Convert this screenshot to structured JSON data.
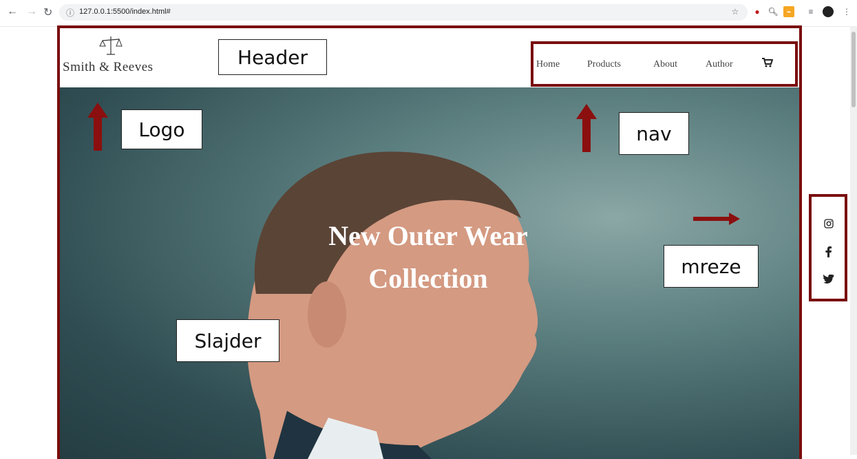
{
  "browser": {
    "url": "127.0.0.1:5500/index.html#",
    "back_icon": "arrow-left",
    "forward_icon": "arrow-right",
    "reload_icon": "reload"
  },
  "header": {
    "logo_text": "Smith & Reeves",
    "nav": [
      "Home",
      "Products",
      "About",
      "Author"
    ],
    "cart_icon": "cart-icon"
  },
  "slider": {
    "title_line1": "New Outer Wear",
    "title_line2": "Collection"
  },
  "annotations": {
    "header": "Header",
    "logo": "Logo",
    "nav": "nav",
    "mreze": "mreze",
    "slajder": "Slajder"
  },
  "social": [
    "instagram-icon",
    "facebook-icon",
    "twitter-icon"
  ],
  "colors": {
    "frame": "#7a0c0c"
  }
}
